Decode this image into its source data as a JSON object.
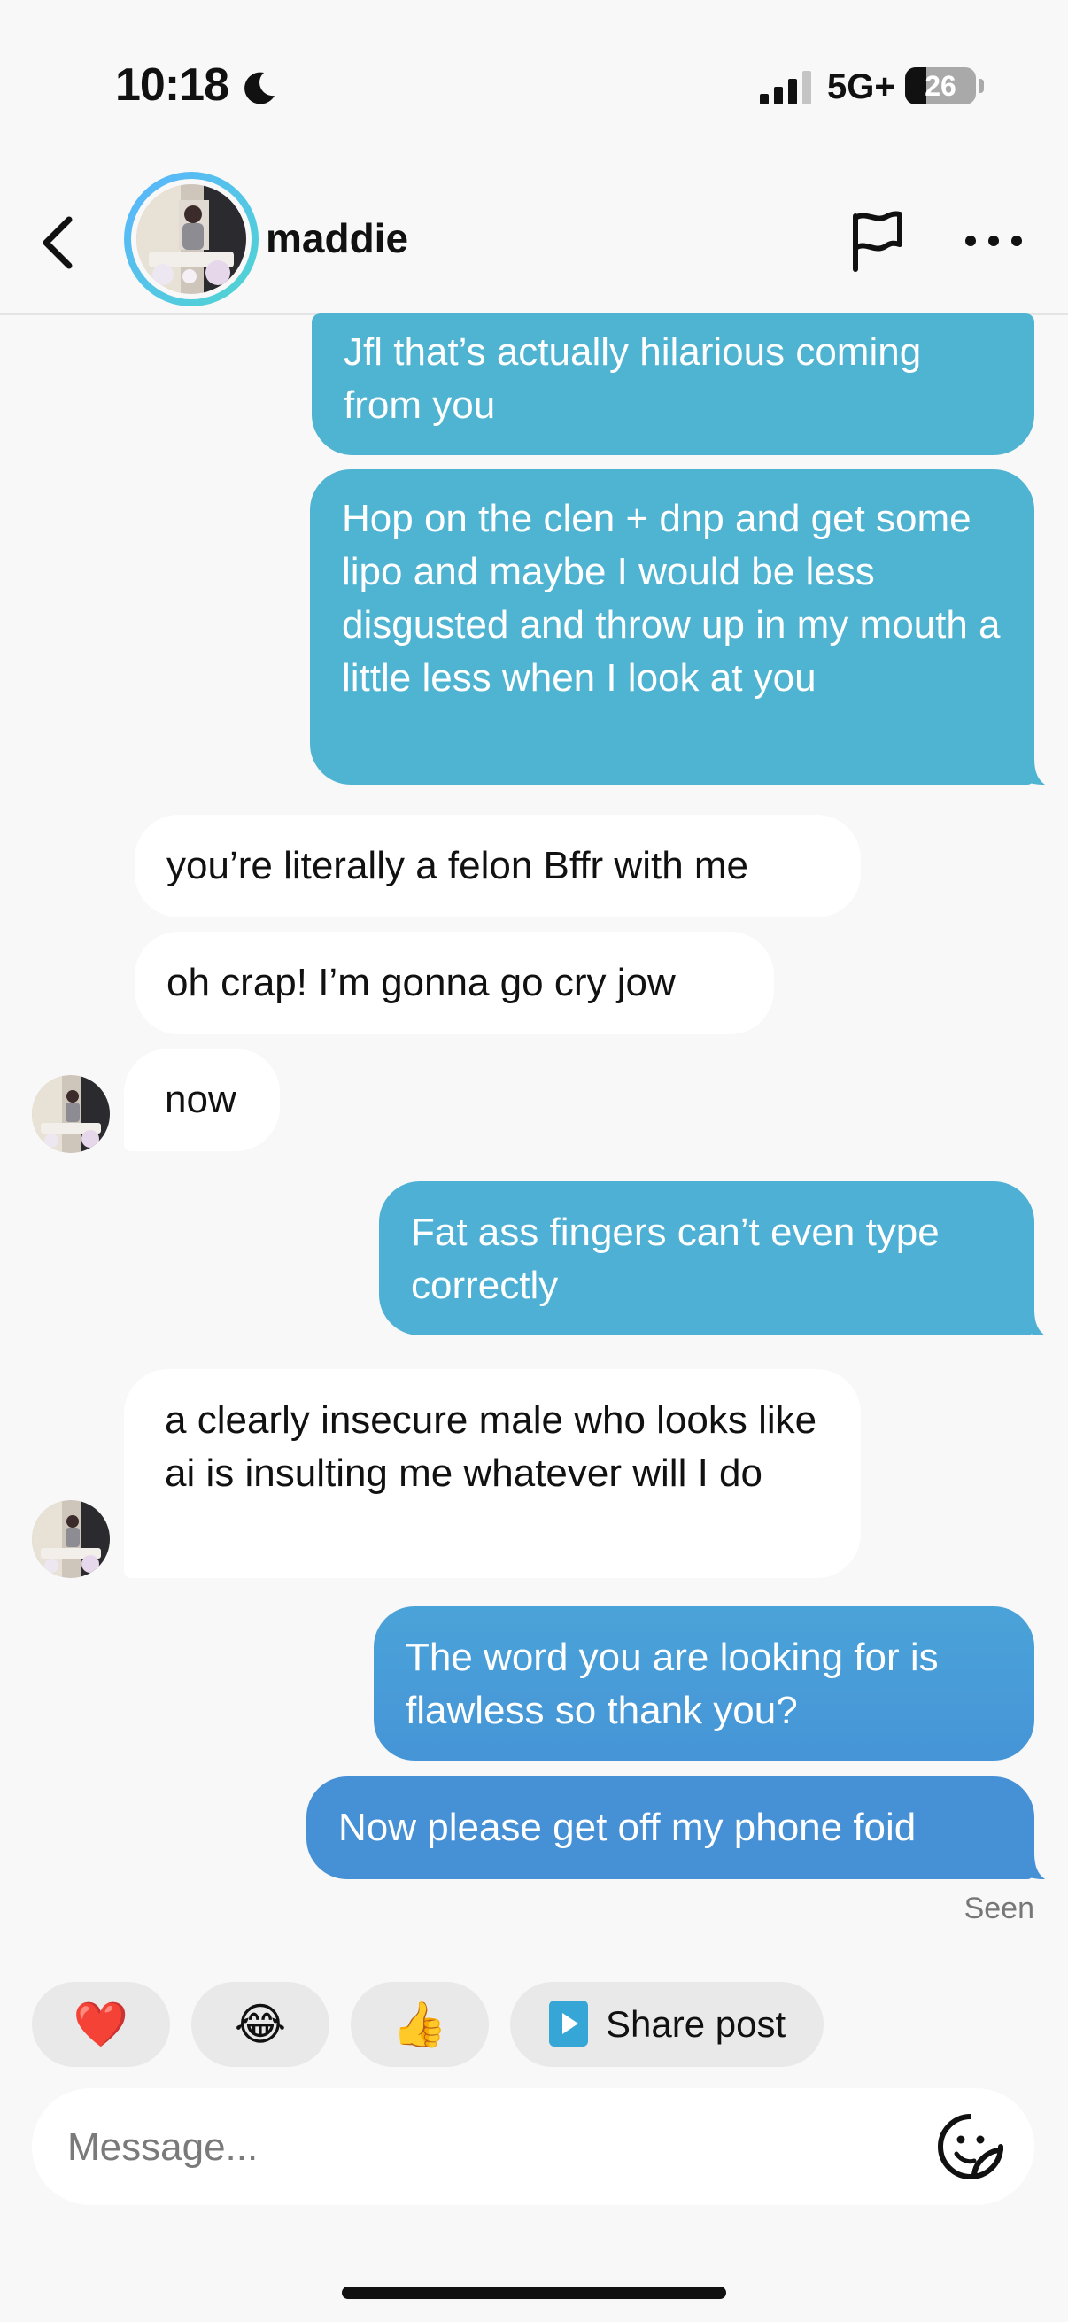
{
  "status_bar": {
    "time": "10:18",
    "network": "5G+",
    "battery": "26"
  },
  "header": {
    "name": "maddie"
  },
  "messages": [
    {
      "direction": "out",
      "text": "Jfl that’s actually hilarious coming from you"
    },
    {
      "direction": "out",
      "text": "Hop on the clen + dnp and get some lipo and maybe I would be less disgusted and throw up in my mouth a little less when I look at you"
    },
    {
      "direction": "in",
      "text": "you’re literally a felon Bffr with me"
    },
    {
      "direction": "in",
      "text": "oh crap! I’m gonna go cry jow"
    },
    {
      "direction": "in",
      "text": "now"
    },
    {
      "direction": "out",
      "text": "Fat ass fingers can’t even type correctly"
    },
    {
      "direction": "in",
      "text": "a clearly insecure male who looks like ai is insulting me whatever will I do"
    },
    {
      "direction": "out",
      "text": "The word you are looking for is flawless so thank you?"
    },
    {
      "direction": "out",
      "text": "Now please get off my phone foid"
    }
  ],
  "seen_label": "Seen",
  "reactions": {
    "heart": "❤️",
    "laugh": "😂",
    "thumbs_up": "👍",
    "share_label": "Share post"
  },
  "composer": {
    "placeholder": "Message..."
  },
  "colors": {
    "outgoing_bubble": "#4fb3d2",
    "outgoing_bubble_bottom": "#4690d6",
    "incoming_bubble": "#ffffff",
    "background": "#f8f8f8",
    "avatar_ring": "#5ab3ff"
  },
  "icons": {
    "back": "chevron-left-icon",
    "report": "flag-icon",
    "more": "ellipsis-icon",
    "share": "play-square-icon",
    "sticker": "sticker-smiley-icon",
    "do_not_disturb": "moon-icon"
  }
}
